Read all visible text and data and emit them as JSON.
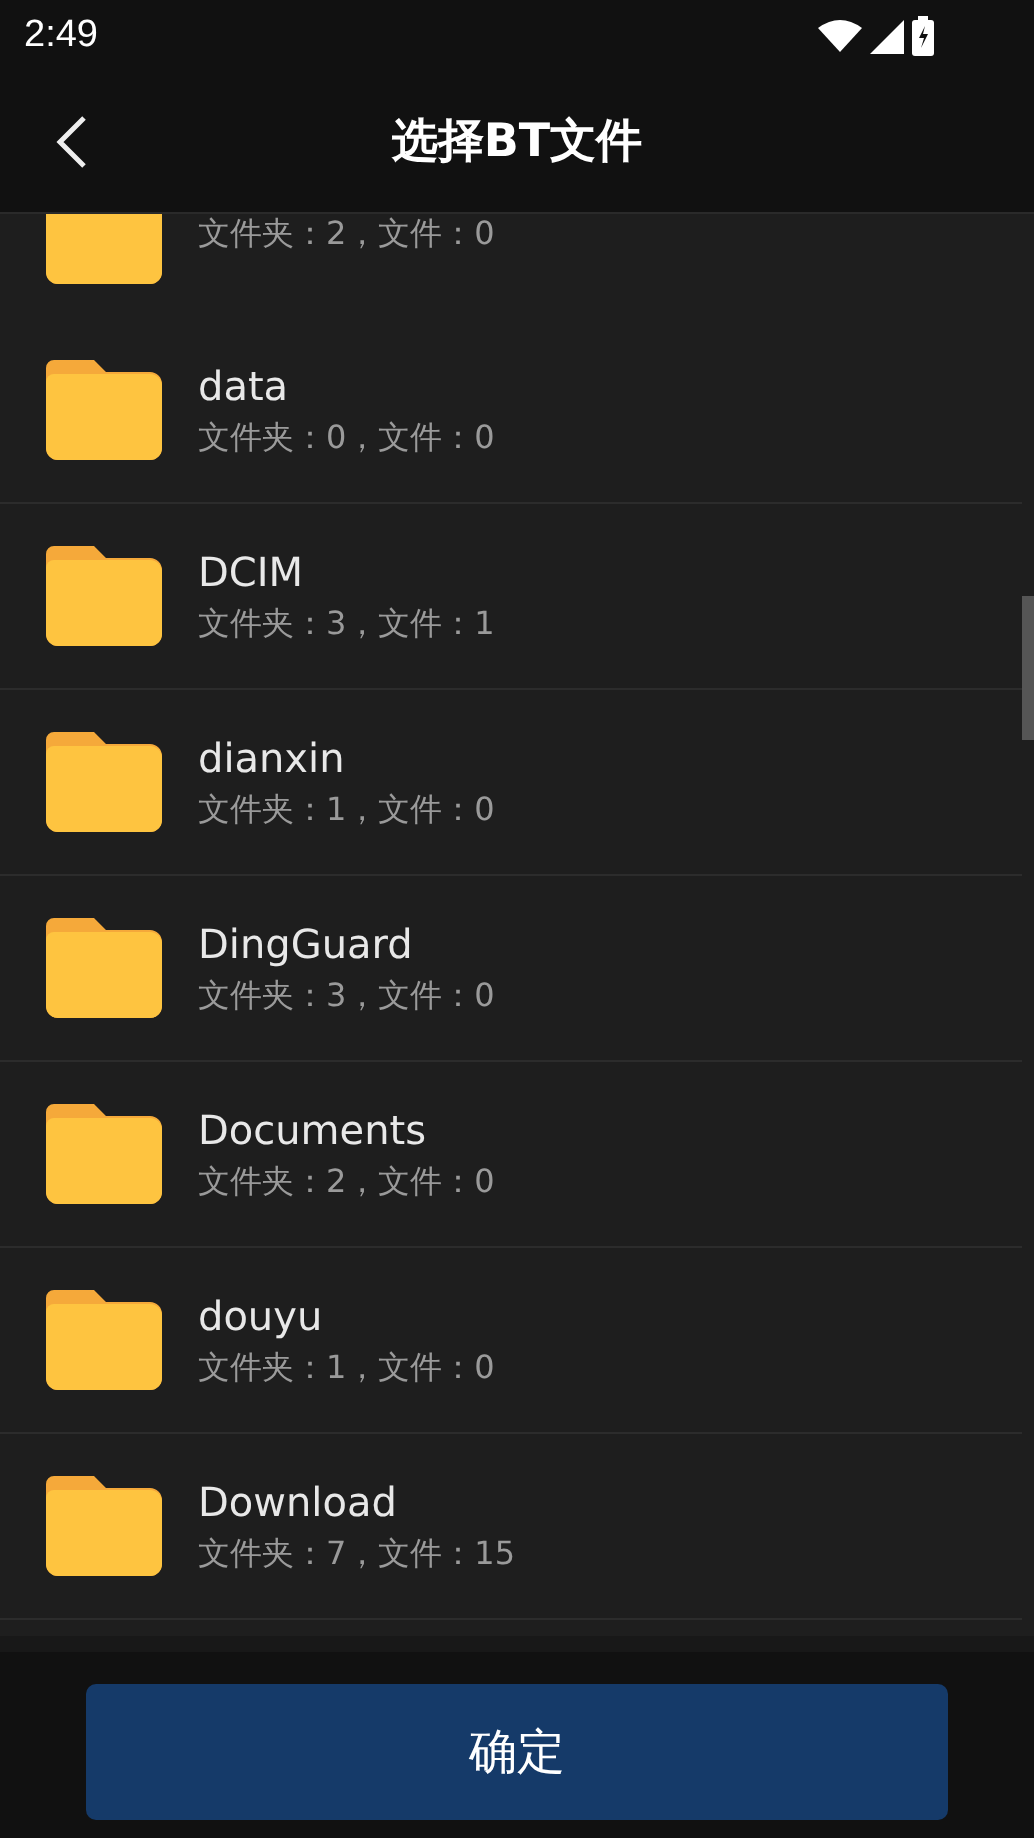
{
  "status_bar": {
    "time": "2:49"
  },
  "app_bar": {
    "title": "选择BT文件"
  },
  "folders": [
    {
      "detail": "文件夹：2，文件：0",
      "cut": true
    },
    {
      "name": "data",
      "detail": "文件夹：0，文件：0"
    },
    {
      "name": "DCIM",
      "detail": "文件夹：3，文件：1"
    },
    {
      "name": "dianxin",
      "detail": "文件夹：1，文件：0"
    },
    {
      "name": "DingGuard",
      "detail": "文件夹：3，文件：0"
    },
    {
      "name": "Documents",
      "detail": "文件夹：2，文件：0"
    },
    {
      "name": "douyu",
      "detail": "文件夹：1，文件：0"
    },
    {
      "name": "Download",
      "detail": "文件夹：7，文件：15"
    }
  ],
  "confirm_button": "确定"
}
